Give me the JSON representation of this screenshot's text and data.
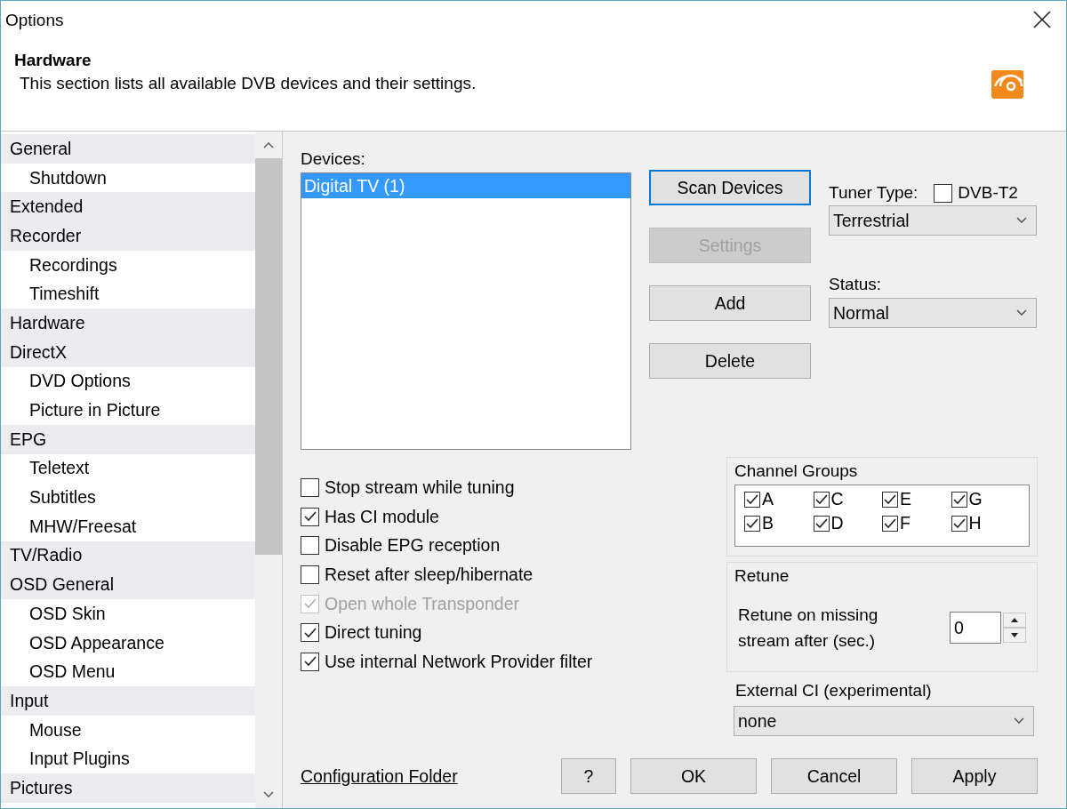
{
  "window": {
    "title": "Options"
  },
  "header": {
    "title": "Hardware",
    "description": "This section lists all available DVB devices and their settings."
  },
  "sidebar": {
    "items": [
      {
        "label": "General",
        "children": [
          {
            "label": "Shutdown"
          }
        ]
      },
      {
        "label": "Extended"
      },
      {
        "label": "Recorder",
        "children": [
          {
            "label": "Recordings"
          },
          {
            "label": "Timeshift"
          }
        ]
      },
      {
        "label": "Hardware"
      },
      {
        "label": "DirectX",
        "children": [
          {
            "label": "DVD Options"
          },
          {
            "label": "Picture in Picture"
          }
        ]
      },
      {
        "label": "EPG",
        "children": [
          {
            "label": "Teletext"
          },
          {
            "label": "Subtitles"
          },
          {
            "label": "MHW/Freesat"
          }
        ]
      },
      {
        "label": "TV/Radio"
      },
      {
        "label": "OSD General",
        "children": [
          {
            "label": "OSD Skin"
          },
          {
            "label": "OSD Appearance"
          },
          {
            "label": "OSD Menu"
          }
        ]
      },
      {
        "label": "Input",
        "children": [
          {
            "label": "Mouse"
          },
          {
            "label": "Input Plugins"
          }
        ]
      },
      {
        "label": "Pictures"
      }
    ]
  },
  "devices": {
    "label": "Devices:",
    "items": [
      {
        "label": "Digital TV (1)",
        "selected": true
      }
    ]
  },
  "device_buttons": [
    {
      "label": "Scan Devices",
      "disabled": false,
      "focused": true
    },
    {
      "label": "Settings",
      "disabled": true,
      "focused": false
    },
    {
      "label": "Add",
      "disabled": false,
      "focused": false
    },
    {
      "label": "Delete",
      "disabled": false,
      "focused": false
    }
  ],
  "tuner_type": {
    "label": "Tuner Type:",
    "dvbt2": {
      "label": "DVB-T2",
      "checked": false
    },
    "value": "Terrestrial"
  },
  "status": {
    "label": "Status:",
    "value": "Normal"
  },
  "options": [
    {
      "label": "Stop stream while tuning",
      "checked": false,
      "disabled": false
    },
    {
      "label": "Has CI module",
      "checked": true,
      "disabled": false
    },
    {
      "label": "Disable EPG reception",
      "checked": false,
      "disabled": false
    },
    {
      "label": "Reset after sleep/hibernate",
      "checked": false,
      "disabled": false
    },
    {
      "label": "Open whole Transponder",
      "checked": true,
      "disabled": true
    },
    {
      "label": "Direct tuning",
      "checked": true,
      "disabled": false
    },
    {
      "label": "Use internal Network Provider filter",
      "checked": true,
      "disabled": false
    }
  ],
  "channel_groups": {
    "title": "Channel Groups",
    "items": [
      {
        "label": "A",
        "checked": true
      },
      {
        "label": "C",
        "checked": true
      },
      {
        "label": "E",
        "checked": true
      },
      {
        "label": "G",
        "checked": true
      },
      {
        "label": "B",
        "checked": true
      },
      {
        "label": "D",
        "checked": true
      },
      {
        "label": "F",
        "checked": true
      },
      {
        "label": "H",
        "checked": true
      }
    ]
  },
  "retune": {
    "title": "Retune",
    "label": "Retune on missing stream after (sec.)",
    "value": "0"
  },
  "external_ci": {
    "label": "External CI (experimental)",
    "value": "none"
  },
  "footer": {
    "link": "Configuration Folder",
    "buttons": [
      "?",
      "OK",
      "Cancel",
      "Apply"
    ]
  }
}
